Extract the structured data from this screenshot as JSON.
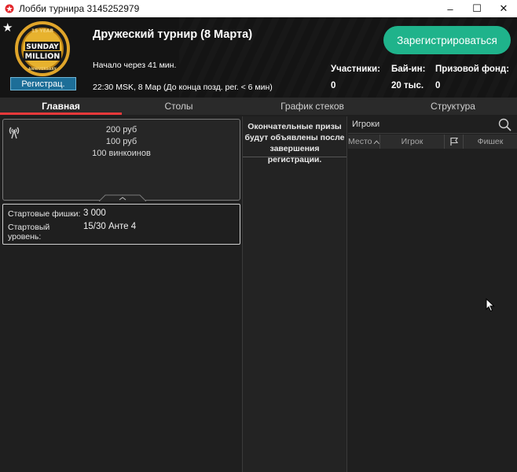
{
  "window": {
    "title": "Лобби турнира 3145252979",
    "controls": [
      "–",
      "☐",
      "✕"
    ]
  },
  "header": {
    "logo": {
      "top_text": "15 YEAR",
      "line1": "SUNDAY",
      "line2": "MILLION",
      "bottom_text": "ANNIVERSARY"
    },
    "status_badge": "Регистрац.",
    "tournament_name": "Дружеский турнир (8 Марта)",
    "starts_in": "Начало через 41 мин.",
    "datetime": "22:30 MSK, 8 Мар (До конца позд. рег. < 6 мин)",
    "register_button": "Зарегистрироваться",
    "stats": {
      "participants_label": "Участники:",
      "participants_value": "0",
      "buyin_label": "Бай-ин:",
      "buyin_value": "20 тыс.",
      "prizepool_label": "Призовой фонд:",
      "prizepool_value": "0"
    }
  },
  "tabs": [
    "Главная",
    "Столы",
    "График стеков",
    "Структура"
  ],
  "active_tab": 0,
  "prizes": [
    "200 руб",
    "100 руб",
    "100 винкоинов"
  ],
  "start_info": {
    "chips_label": "Стартовые фишки:",
    "chips_value": "3 000",
    "level_label_1": "Стартовый",
    "level_label_2": "уровень:",
    "level_value": "15/30 Анте 4"
  },
  "prize_note": {
    "line1": "Окончательные призы",
    "line2": "будут объявлены после",
    "line3": "завершения регистрации."
  },
  "players": {
    "search_placeholder": "Игроки",
    "columns": {
      "place": "Место",
      "player": "Игрок",
      "chips": "Фишек"
    }
  },
  "colors": {
    "accent_green": "#1fb38b",
    "tab_underline": "#e8393a",
    "badge_blue": "#1d6e98"
  }
}
